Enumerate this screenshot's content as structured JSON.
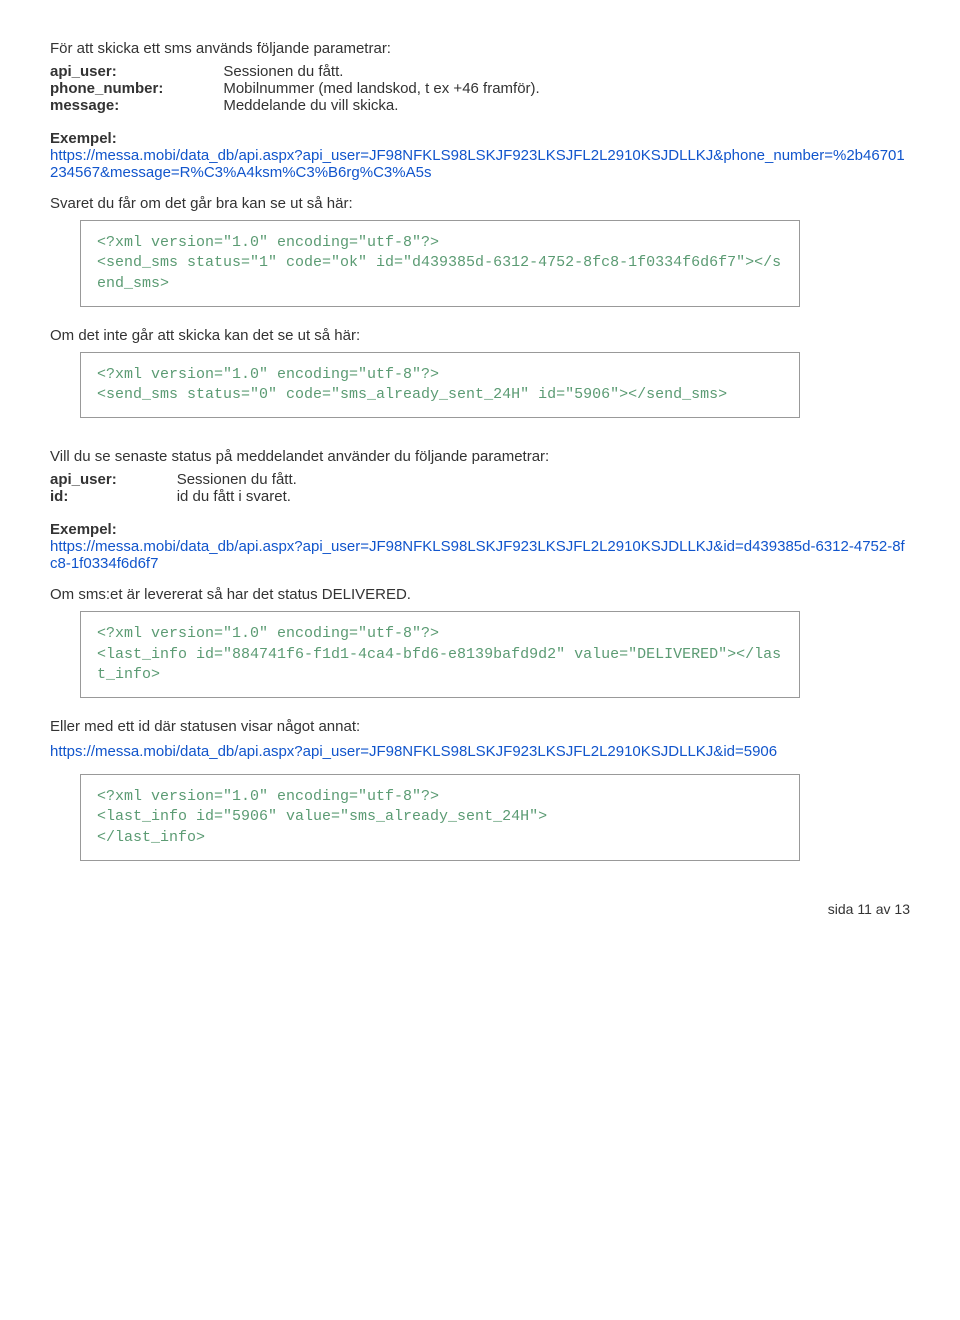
{
  "section1": {
    "intro": "För att skicka ett sms används följande parametrar:",
    "params": [
      {
        "key": "api_user:",
        "val": "Sessionen du fått."
      },
      {
        "key": "phone_number:",
        "val": "Mobilnummer (med landskod, t ex +46 framför)."
      },
      {
        "key": "message:",
        "val": "Meddelande du vill skicka."
      }
    ],
    "example_label": "Exempel:",
    "example_url": "https://messa.mobi/data_db/api.aspx?api_user=JF98NFKLS98LSKJF923LKSJFL2L2910KSJDLLKJ&phone_number=%2b46701234567&message=R%C3%A4ksm%C3%B6rg%C3%A5s",
    "response_ok_label": "Svaret du får om det går bra kan se ut så här:",
    "code_ok": "<?xml version=\"1.0\" encoding=\"utf-8\"?>\n<send_sms status=\"1\" code=\"ok\" id=\"d439385d-6312-4752-8fc8-1f0334f6d6f7\"></send_sms>",
    "response_fail_label": "Om det inte går att skicka kan det se ut så här:",
    "code_fail": "<?xml version=\"1.0\" encoding=\"utf-8\"?>\n<send_sms status=\"0\" code=\"sms_already_sent_24H\" id=\"5906\"></send_sms>"
  },
  "section2": {
    "intro": "Vill du se senaste status på meddelandet använder du följande parametrar:",
    "params": [
      {
        "key": "api_user:",
        "val": "Sessionen du fått."
      },
      {
        "key": "id:",
        "val": "id du fått i svaret."
      }
    ],
    "example_label": "Exempel:",
    "example_url": "https://messa.mobi/data_db/api.aspx?api_user=JF98NFKLS98LSKJF923LKSJFL2L2910KSJDLLKJ&id=d439385d-6312-4752-8fc8-1f0334f6d6f7",
    "delivered_label": "Om sms:et är levererat så har det status DELIVERED.",
    "code_delivered": "<?xml version=\"1.0\" encoding=\"utf-8\"?>\n<last_info id=\"884741f6-f1d1-4ca4-bfd6-e8139bafd9d2\" value=\"DELIVERED\"></last_info>",
    "other_label": "Eller med ett id där statusen visar något annat:",
    "other_url": "https://messa.mobi/data_db/api.aspx?api_user=JF98NFKLS98LSKJF923LKSJFL2L2910KSJDLLKJ&id=5906",
    "code_other": "<?xml version=\"1.0\" encoding=\"utf-8\"?>\n<last_info id=\"5906\" value=\"sms_already_sent_24H\">\n</last_info>"
  },
  "footer": "sida 11 av 13"
}
